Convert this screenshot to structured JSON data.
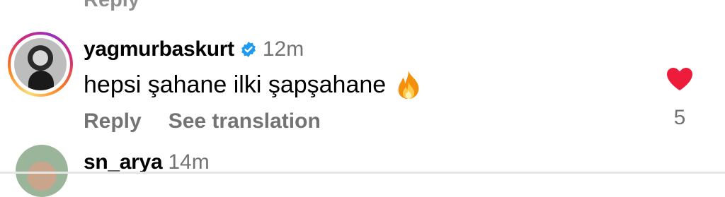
{
  "previous_comment": {
    "reply_label": "Reply"
  },
  "comment": {
    "username": "yagmurbaskurt",
    "verified": true,
    "time": "12m",
    "text": "hepsi şahane ilki şapşahane",
    "emoji": "fire-icon",
    "reply_label": "Reply",
    "translation_label": "See translation",
    "like_count": "5",
    "liked": true
  },
  "next_comment": {
    "username": "sn_arya",
    "time": "14m"
  },
  "colors": {
    "heart": "#ed1c3a",
    "verified": "#1d9bf0",
    "muted": "#737373"
  }
}
